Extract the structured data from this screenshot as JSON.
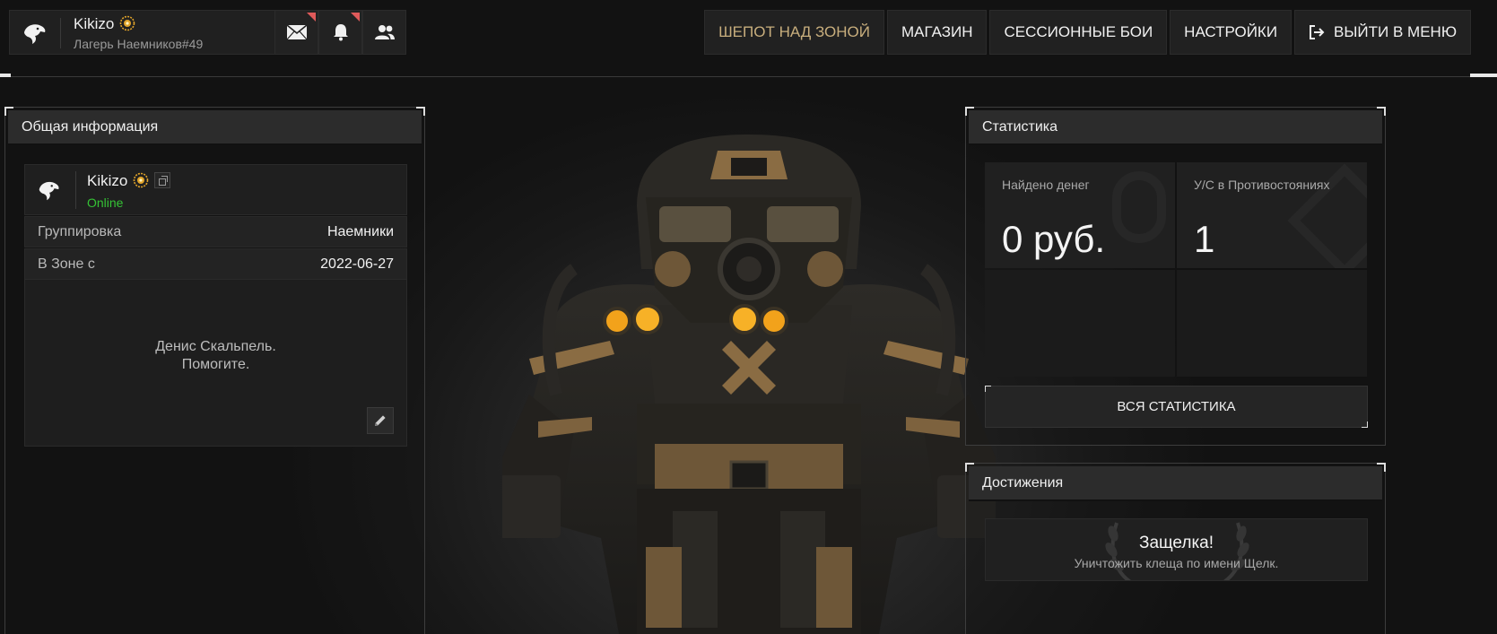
{
  "colors": {
    "accent_gold": "#c8ae7d",
    "online_green": "#35c335",
    "notification_red": "#e05a5a"
  },
  "header": {
    "player_name": "Kikizo",
    "player_sub": "Лагерь Наемников#49",
    "icons": [
      "mail-icon",
      "bell-icon",
      "friends-icon"
    ],
    "nav": [
      {
        "label": "ШЕПОТ НАД ЗОНОЙ",
        "active": true
      },
      {
        "label": "МАГАЗИН"
      },
      {
        "label": "СЕССИОННЫЕ БОИ"
      },
      {
        "label": "НАСТРОЙКИ"
      },
      {
        "label": "ВЫЙТИ В МЕНЮ",
        "icon": "exit-icon"
      }
    ]
  },
  "general_info": {
    "title": "Общая информация",
    "name": "Kikizo",
    "status": "Online",
    "rows": [
      {
        "label": "Группировка",
        "value": "Наемники"
      },
      {
        "label": "В Зоне с",
        "value": "2022-06-27"
      }
    ],
    "bio_line1": "Денис Скальпель.",
    "bio_line2": "Помогите."
  },
  "statistics": {
    "title": "Статистика",
    "cells": [
      {
        "label": "Найдено денег",
        "value": "0 руб."
      },
      {
        "label": "У/С в Противостояниях",
        "value": "1"
      }
    ],
    "all_button": "ВСЯ СТАТИСТИКА"
  },
  "achievements": {
    "title": "Достижения",
    "item_title": "Защелка!",
    "item_desc": "Уничтожить клеща по имени Щелк."
  }
}
